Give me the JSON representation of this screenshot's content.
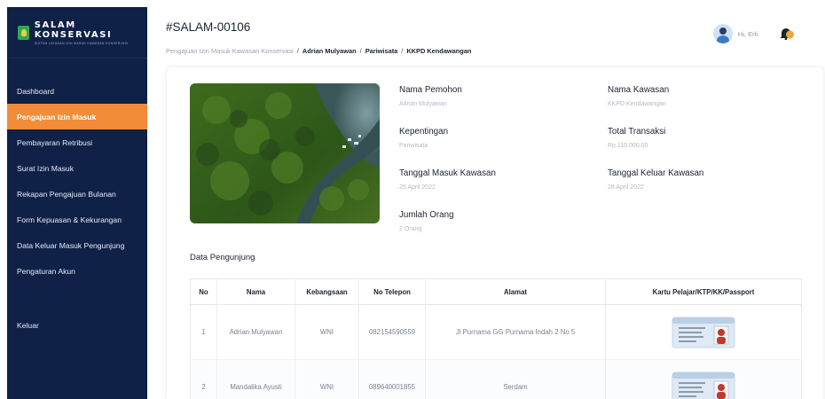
{
  "brand": {
    "title": "SALAM KONSERVASI",
    "subtitle": "SISTEM LAYANAN IZIN MASUK KAWASAN KONSERVASI"
  },
  "sidebar": {
    "items": [
      {
        "label": "Dashboard",
        "active": false
      },
      {
        "label": "Pengajuan Izin Masuk",
        "active": true
      },
      {
        "label": "Pembayaran Retribusi",
        "active": false
      },
      {
        "label": "Surat Izin Masuk",
        "active": false
      },
      {
        "label": "Rekapan Pengajuan Bulanan",
        "active": false
      },
      {
        "label": "Form Kepuasan & Kekurangan",
        "active": false
      },
      {
        "label": "Data Keluar Masuk Pengunjung",
        "active": false
      },
      {
        "label": "Pengaturan Akun",
        "active": false
      }
    ],
    "logout_label": "Keluar"
  },
  "header": {
    "page_id": "#SALAM-00106",
    "breadcrumb": {
      "root": "Pengajuan Izin Masuk Kawasan Konservasi",
      "sep": "/",
      "applicant": "Adrian Mulyawan",
      "purpose": "Pariwisata",
      "area": "KKPD Kendawangan"
    },
    "greeting": "Hi, Erli"
  },
  "details": {
    "nama_pemohon": {
      "label": "Nama Pemohon",
      "value": "Adrian Mulyawan"
    },
    "kepentingan": {
      "label": "Kepentingan",
      "value": "Pariwisata"
    },
    "tanggal_masuk": {
      "label": "Tanggal Masuk Kawasan",
      "value": "25 April 2022"
    },
    "jumlah_orang": {
      "label": "Jumlah Orang",
      "value": "2 Orang"
    },
    "nama_kawasan": {
      "label": "Nama Kawasan",
      "value": "KKPD Kendawangan"
    },
    "total_transaksi": {
      "label": "Total Transaksi",
      "value": "Rp 110.000,00"
    },
    "tanggal_keluar": {
      "label": "Tanggal Keluar Kawasan",
      "value": "28 April 2022"
    }
  },
  "visitors": {
    "title": "Data Pengunjung",
    "headers": [
      "No",
      "Nama",
      "Kebangsaan",
      "No Telepon",
      "Alamat",
      "Kartu Pelajar/KTP/KK/Passport"
    ],
    "rows": [
      {
        "no": "1",
        "nama": "Adrian Mulyawan",
        "kebangsaan": "WNI",
        "telepon": "082154590559",
        "alamat": "Jl Purnama GG Purnama Indah 2 No 5"
      },
      {
        "no": "2",
        "nama": "Mandalika Ayusti",
        "kebangsaan": "WNI",
        "telepon": "089640001855",
        "alamat": "Serdam"
      }
    ]
  },
  "colors": {
    "sidebar_bg": "#0f2147",
    "active_item": "#f28c38",
    "bell": "#f2a33a"
  },
  "icons": [
    "brand-logo-icon",
    "avatar",
    "bell-icon",
    "id-card-icon"
  ]
}
